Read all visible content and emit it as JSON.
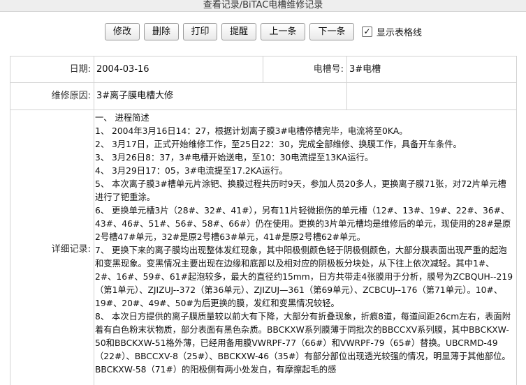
{
  "window": {
    "title": "查看记录/BiTAC电槽维修记录"
  },
  "toolbar": {
    "buttons": [
      {
        "label": "修改"
      },
      {
        "label": "删除"
      },
      {
        "label": "打印"
      },
      {
        "label": "提醒"
      },
      {
        "label": "上一条"
      },
      {
        "label": "下一条"
      }
    ],
    "show_grid": {
      "label": "显示表格线",
      "checked": true,
      "mark": "✓"
    }
  },
  "form": {
    "date_label": "日期:",
    "date_value": "2004-03-16",
    "cell_label": "电槽号:",
    "cell_value": "3#电槽",
    "reason_label": "维修原因:",
    "reason_value": "3#离子膜电槽大修",
    "detail_label": "详细记录:",
    "detail_lines": [
      "一、 进程简述",
      "1、 2004年3月16日14：27，根据计划离子膜3#电槽停槽完毕，电流将至0KA。",
      "2、 3月17日，正式开始维修工作，至25日22：30，完成全部维修、换膜工作，具备开车条件。",
      "3、 3月26日8：37，3#电槽开始送电，至10：30电流提至13KA运行。",
      "4、 3月29日17：05，3#电流提至17.2KA运行。",
      "5、 本次离子膜3#槽单元片涂钯、换膜过程共历时9天，参加人员20多人，更换离子膜71张，对72片单元槽进行了钯重涂。",
      "6、 更换单元槽3片（28#、32#、41#），另有11片轻微损伤的单元槽（12#、13#、19#、22#、36#、43#、46#、51#、56#、58#、66#）仍在使用。更换的3片单元槽均是维修后的单元，现使用的28#是原2号槽47#单元，32#是原2号槽63#单元，41#是原2号槽62#单元。",
      "7、 更换下来的离子膜均出现整体发红现象，其中阳极侧颜色轻于阴极侧颜色，大部分膜表面出现严重的起泡和变黑现象。变黑情况主要出现在边缘和底部以及相对应的阴极板分块处，从下往上依次减轻。其中1#、2#、16#、59#、61#起泡较多，最大的直径约15mm，日方共带走4张膜用于分析，膜号为ZCBQUH--219（第1单元）、ZJIZUJ--372（第36单元）、ZJIZUJ—361（第69单元）、ZCBCUJ--176（第71单元）。10#、19#、20#、49#、50#为后更换的膜，发红和变黑情况较轻。",
      "8、 本次日方提供的离子膜质量较以前大有下降，大部分有折叠现象，折痕8道，每道间距26cm左右，表面附着有白色粉末状物质，部分表面有黑色杂质。BBCKXW系列膜薄于同批次的BBCCXV系列膜，其中BBCKXW-50和BBCKXW-51格外薄，已经用备用膜VWRPF-77（66#）和VWRPF-79（65#）替换。UBCRMD-49（22#）、BBCCXV-8（25#）、BBCKXW-46（35#）有部分部位出现透光较强的情况，明显薄于其他部位。BBCKXW-58（71#）的阳极侧有两小处发白，有摩擦起毛的感"
    ]
  }
}
